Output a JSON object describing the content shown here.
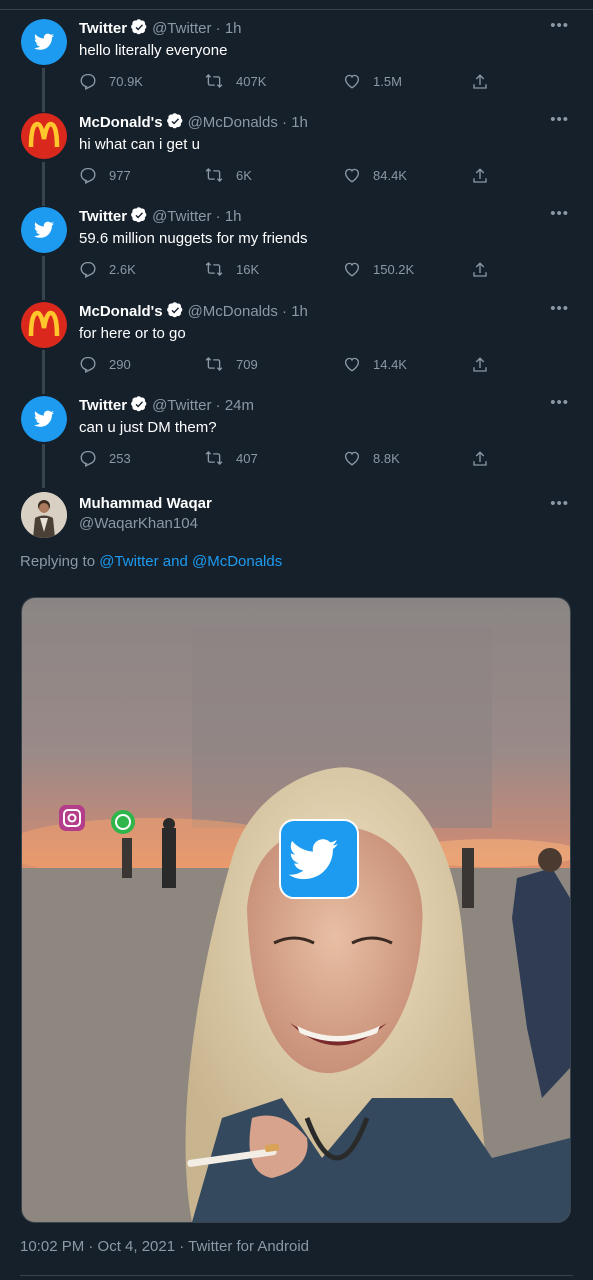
{
  "tweets": [
    {
      "name": "Twitter",
      "handle": "@Twitter",
      "time": "1h",
      "text": "hello literally everyone",
      "replies": "70.9K",
      "retweets": "407K",
      "likes": "1.5M",
      "avatar": "twitter-logo"
    },
    {
      "name": "McDonald's",
      "handle": "@McDonalds",
      "time": "1h",
      "text": "hi what can i get u",
      "replies": "977",
      "retweets": "6K",
      "likes": "84.4K",
      "avatar": "mcdonalds-logo"
    },
    {
      "name": "Twitter",
      "handle": "@Twitter",
      "time": "1h",
      "text": "59.6 million nuggets for my friends",
      "replies": "2.6K",
      "retweets": "16K",
      "likes": "150.2K",
      "avatar": "twitter-logo"
    },
    {
      "name": "McDonald's",
      "handle": "@McDonalds",
      "time": "1h",
      "text": "for here or to go",
      "replies": "290",
      "retweets": "709",
      "likes": "14.4K",
      "avatar": "mcdonalds-logo"
    },
    {
      "name": "Twitter",
      "handle": "@Twitter",
      "time": "24m",
      "text": "can u just DM them?",
      "replies": "253",
      "retweets": "407",
      "likes": "8.8K",
      "avatar": "twitter-logo"
    }
  ],
  "main_tweet": {
    "name": "Muhammad Waqar",
    "handle": "@WaqarKhan104",
    "replying_prefix": "Replying to ",
    "replying_to": "@Twitter and @McDonalds",
    "meta": "10:02 PM · Oct 4, 2021 · Twitter for Android"
  },
  "ui": {
    "dot": "·",
    "more": "•••"
  },
  "colors": {
    "background": "#15202b",
    "accent": "#1d9bf0",
    "muted": "#8b98a5",
    "divider": "#38444d",
    "mcd_red": "#da291c",
    "mcd_yellow": "#ffc72c"
  }
}
